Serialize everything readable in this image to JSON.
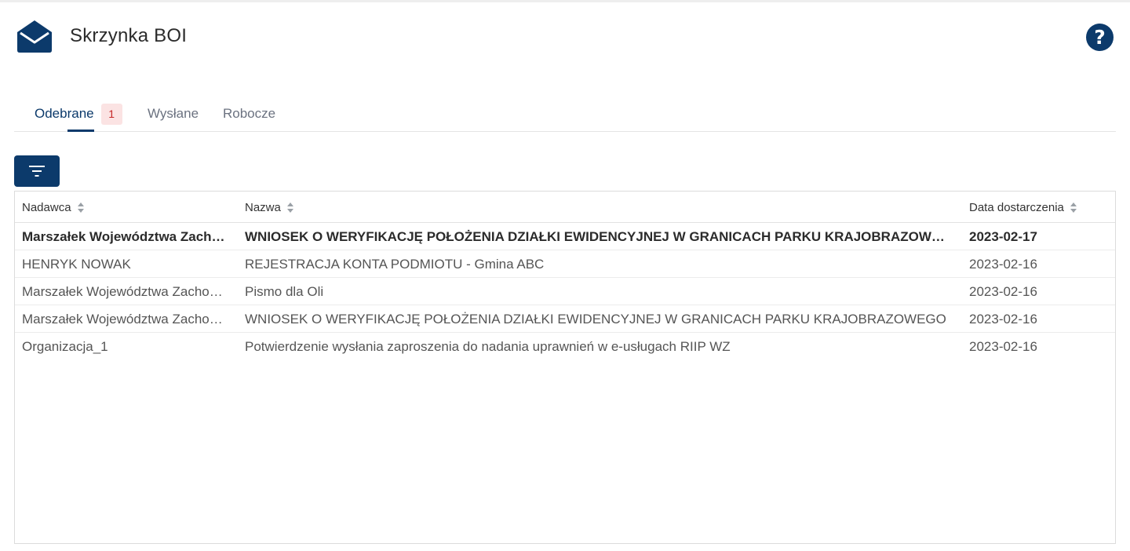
{
  "app": {
    "title": "Skrzynka BOI"
  },
  "icons": {
    "logo": "envelope-open-icon",
    "help": "question-circle-icon",
    "filter": "filter-icon",
    "sort": "sort-icon"
  },
  "colors": {
    "primary": "#0c3a6b",
    "badge_bg": "#fbe3e3",
    "badge_text": "#c62828"
  },
  "tabs": [
    {
      "label": "Odebrane",
      "badge": "1",
      "active": true
    },
    {
      "label": "Wysłane",
      "active": false
    },
    {
      "label": "Robocze",
      "active": false
    }
  ],
  "table": {
    "headers": [
      "Nadawca",
      "Nazwa",
      "Data dostarczenia"
    ],
    "rows": [
      {
        "sender": "Marszałek Województwa Zachodniopomorskiego",
        "name": "WNIOSEK O WERYFIKACJĘ POŁOŻENIA DZIAŁKI EWIDENCYJNEJ W GRANICACH PARKU KRAJOBRAZOWEGO",
        "date": "2023-02-17",
        "unread": true
      },
      {
        "sender": "HENRYK NOWAK",
        "name": "REJESTRACJA KONTA PODMIOTU - Gmina ABC",
        "date": "2023-02-16",
        "unread": false
      },
      {
        "sender": "Marszałek Województwa Zachodniopomorskiego",
        "name": "Pismo dla Oli",
        "date": "2023-02-16",
        "unread": false
      },
      {
        "sender": "Marszałek Województwa Zachodniopomorskiego",
        "name": "WNIOSEK O WERYFIKACJĘ POŁOŻENIA DZIAŁKI EWIDENCYJNEJ W GRANICACH PARKU KRAJOBRAZOWEGO",
        "date": "2023-02-16",
        "unread": false
      },
      {
        "sender": "Organizacja_1",
        "name": "Potwierdzenie wysłania zaproszenia do nadania uprawnień w e-usługach RIIP WZ",
        "date": "2023-02-16",
        "unread": false
      }
    ]
  }
}
